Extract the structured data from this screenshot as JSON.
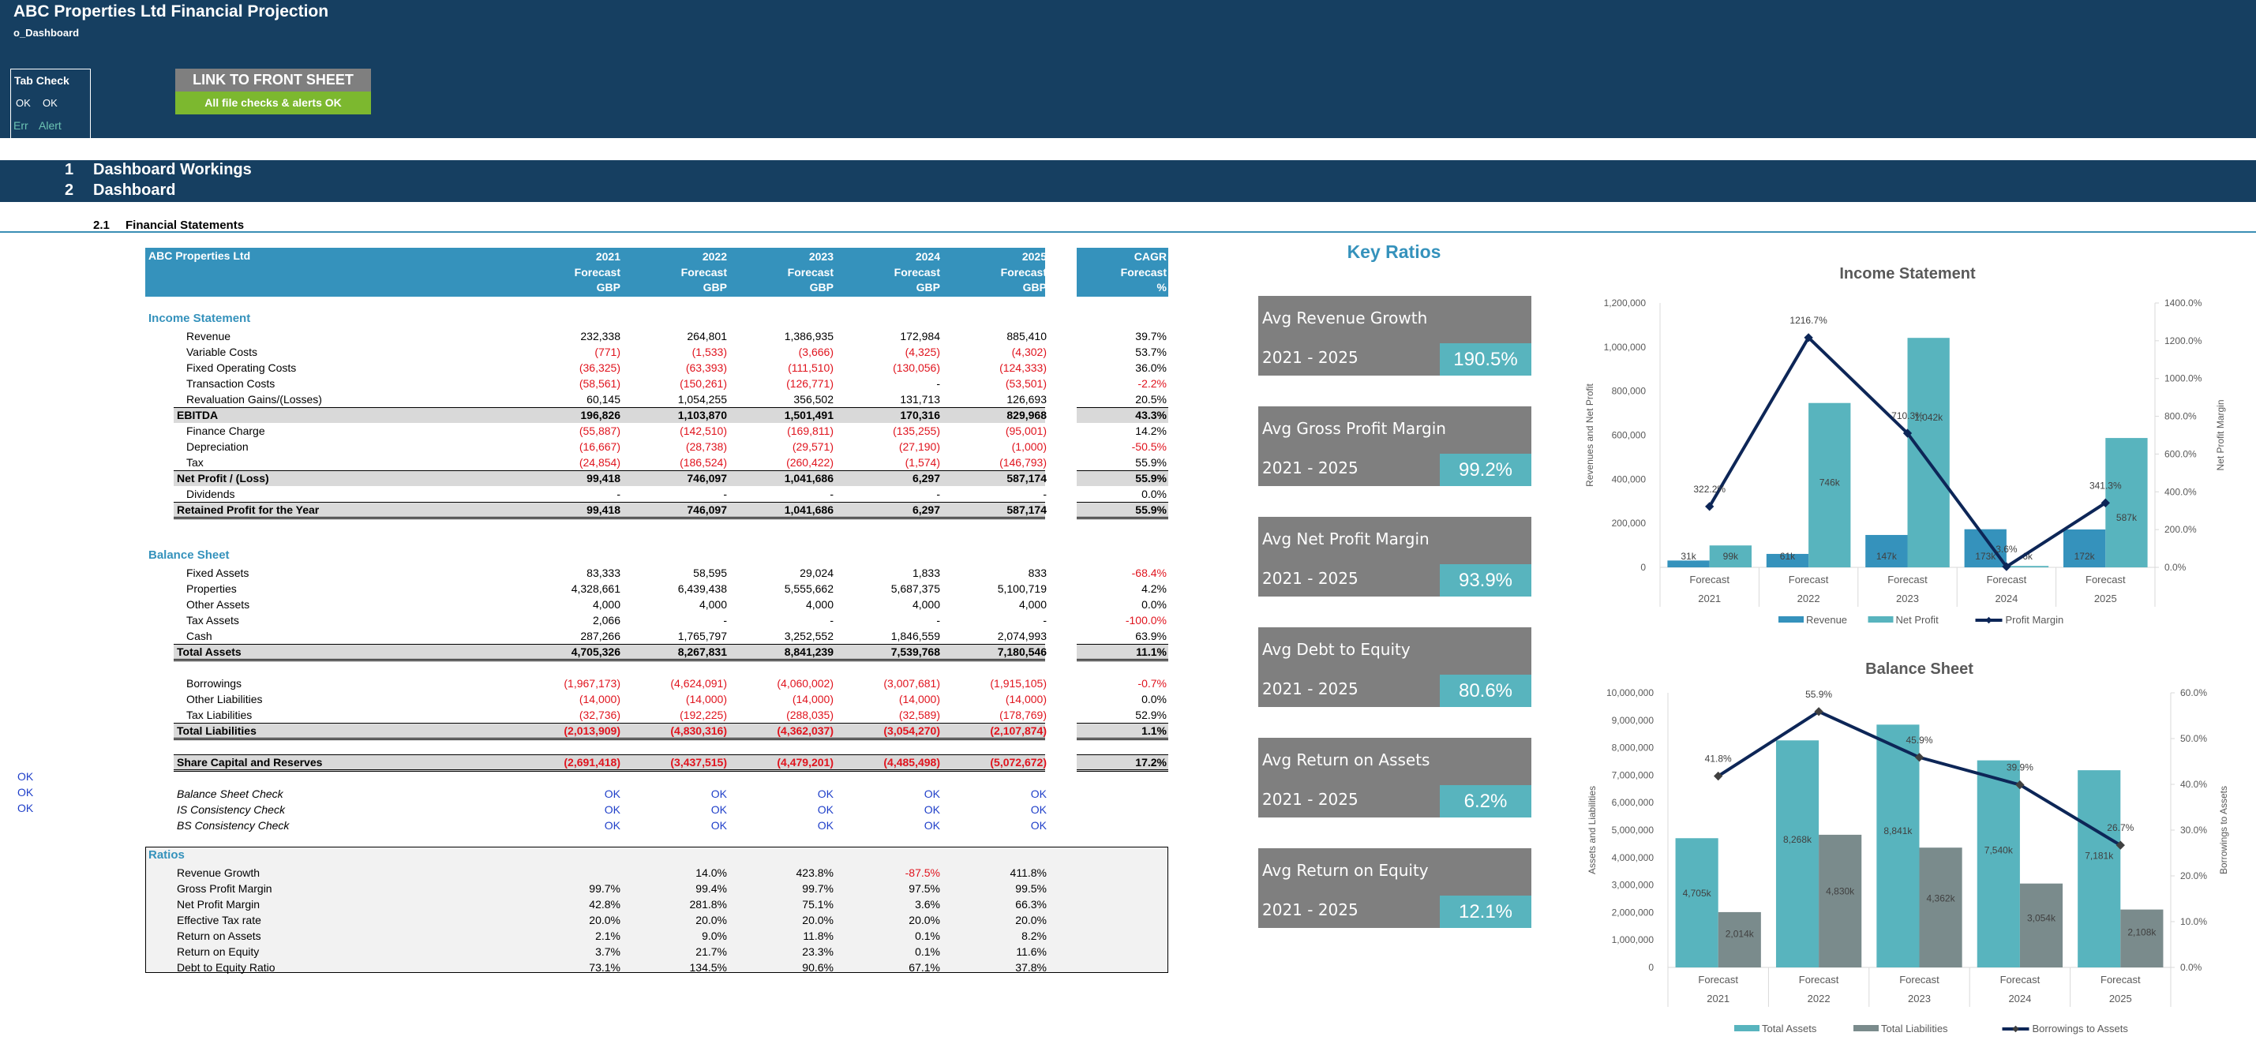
{
  "header": {
    "title": "ABC Properties Ltd Financial Projection",
    "sheet": "o_Dashboard",
    "tab_check": {
      "title": "Tab Check",
      "ok1": "OK",
      "ok2": "OK",
      "err": "Err",
      "alert": "Alert"
    },
    "link_button": "LINK TO FRONT SHEET",
    "checks_status": "All file checks & alerts OK"
  },
  "sections": [
    {
      "num": "1",
      "label": "Dashboard Workings"
    },
    {
      "num": "2",
      "label": "Dashboard"
    }
  ],
  "subsection": {
    "num": "2.1",
    "label": "Financial Statements"
  },
  "table": {
    "company": "ABC Properties Ltd",
    "columns": [
      {
        "year": "2021",
        "type": "Forecast",
        "unit": "GBP"
      },
      {
        "year": "2022",
        "type": "Forecast",
        "unit": "GBP"
      },
      {
        "year": "2023",
        "type": "Forecast",
        "unit": "GBP"
      },
      {
        "year": "2024",
        "type": "Forecast",
        "unit": "GBP"
      },
      {
        "year": "2025",
        "type": "Forecast",
        "unit": "GBP"
      }
    ],
    "cagr": {
      "label": "CAGR",
      "type": "Forecast",
      "unit": "%"
    },
    "income_statement": {
      "title": "Income Statement",
      "rows": [
        {
          "label": "Revenue",
          "kind": "item",
          "values": [
            "232,338",
            "264,801",
            "1,386,935",
            "172,984",
            "885,410"
          ],
          "cagr": "39.7%"
        },
        {
          "label": "Variable Costs",
          "kind": "item",
          "values": [
            "(771)",
            "(1,533)",
            "(3,666)",
            "(4,325)",
            "(4,302)"
          ],
          "cagr": "53.7%"
        },
        {
          "label": "Fixed Operating Costs",
          "kind": "item",
          "values": [
            "(36,325)",
            "(63,393)",
            "(111,510)",
            "(130,056)",
            "(124,333)"
          ],
          "cagr": "36.0%"
        },
        {
          "label": "Transaction Costs",
          "kind": "item",
          "values": [
            "(58,561)",
            "(150,261)",
            "(126,771)",
            "-",
            "(53,501)"
          ],
          "cagr": "-2.2%"
        },
        {
          "label": "Revaluation Gains/(Losses)",
          "kind": "item",
          "values": [
            "60,145",
            "1,054,255",
            "356,502",
            "131,713",
            "126,693"
          ],
          "cagr": "20.5%"
        },
        {
          "label": "EBITDA",
          "kind": "total",
          "values": [
            "196,826",
            "1,103,870",
            "1,501,491",
            "170,316",
            "829,968"
          ],
          "cagr": "43.3%"
        },
        {
          "label": "Finance Charge",
          "kind": "item",
          "values": [
            "(55,887)",
            "(142,510)",
            "(169,811)",
            "(135,255)",
            "(95,001)"
          ],
          "cagr": "14.2%"
        },
        {
          "label": "Depreciation",
          "kind": "item",
          "values": [
            "(16,667)",
            "(28,738)",
            "(29,571)",
            "(27,190)",
            "(1,000)"
          ],
          "cagr": "-50.5%"
        },
        {
          "label": "Tax",
          "kind": "item",
          "values": [
            "(24,854)",
            "(186,524)",
            "(260,422)",
            "(1,574)",
            "(146,793)"
          ],
          "cagr": "55.9%"
        },
        {
          "label": "Net Profit / (Loss)",
          "kind": "total",
          "values": [
            "99,418",
            "746,097",
            "1,041,686",
            "6,297",
            "587,174"
          ],
          "cagr": "55.9%"
        },
        {
          "label": "Dividends",
          "kind": "item",
          "values": [
            "-",
            "-",
            "-",
            "-",
            "-"
          ],
          "cagr": "0.0%"
        },
        {
          "label": "Retained Profit for the Year",
          "kind": "total-dbl",
          "values": [
            "99,418",
            "746,097",
            "1,041,686",
            "6,297",
            "587,174"
          ],
          "cagr": "55.9%"
        }
      ]
    },
    "balance_sheet": {
      "title": "Balance Sheet",
      "rows": [
        {
          "label": "Fixed Assets",
          "kind": "item",
          "values": [
            "83,333",
            "58,595",
            "29,024",
            "1,833",
            "833"
          ],
          "cagr": "-68.4%"
        },
        {
          "label": "Properties",
          "kind": "item",
          "values": [
            "4,328,661",
            "6,439,438",
            "5,555,662",
            "5,687,375",
            "5,100,719"
          ],
          "cagr": "4.2%"
        },
        {
          "label": "Other Assets",
          "kind": "item",
          "values": [
            "4,000",
            "4,000",
            "4,000",
            "4,000",
            "4,000"
          ],
          "cagr": "0.0%"
        },
        {
          "label": "Tax Assets",
          "kind": "item",
          "values": [
            "2,066",
            "-",
            "-",
            "-",
            "-"
          ],
          "cagr": "-100.0%"
        },
        {
          "label": "Cash",
          "kind": "item",
          "values": [
            "287,266",
            "1,765,797",
            "3,252,552",
            "1,846,559",
            "2,074,993"
          ],
          "cagr": "63.9%"
        },
        {
          "label": "Total Assets",
          "kind": "total-dbl",
          "values": [
            "4,705,326",
            "8,267,831",
            "8,841,239",
            "7,539,768",
            "7,180,546"
          ],
          "cagr": "11.1%"
        },
        {
          "label": "",
          "kind": "blank"
        },
        {
          "label": "Borrowings",
          "kind": "item",
          "values": [
            "(1,967,173)",
            "(4,624,091)",
            "(4,060,002)",
            "(3,007,681)",
            "(1,915,105)"
          ],
          "cagr": "-0.7%"
        },
        {
          "label": "Other Liabilities",
          "kind": "item",
          "values": [
            "(14,000)",
            "(14,000)",
            "(14,000)",
            "(14,000)",
            "(14,000)"
          ],
          "cagr": "0.0%"
        },
        {
          "label": "Tax Liabilities",
          "kind": "item",
          "values": [
            "(32,736)",
            "(192,225)",
            "(288,035)",
            "(32,589)",
            "(178,769)"
          ],
          "cagr": "52.9%"
        },
        {
          "label": "Total Liabilities",
          "kind": "total-dbl",
          "values": [
            "(2,013,909)",
            "(4,830,316)",
            "(4,362,037)",
            "(3,054,270)",
            "(2,107,874)"
          ],
          "cagr": "1.1%"
        },
        {
          "label": "",
          "kind": "blank"
        },
        {
          "label": "Share Capital and Reserves",
          "kind": "total-dbl",
          "values": [
            "(2,691,418)",
            "(3,437,515)",
            "(4,479,201)",
            "(4,485,498)",
            "(5,072,672)"
          ],
          "cagr": "17.2%"
        }
      ]
    },
    "checks": {
      "left_flags": [
        "OK",
        "OK",
        "OK"
      ],
      "rows": [
        {
          "label": "Balance Sheet Check",
          "values": [
            "OK",
            "OK",
            "OK",
            "OK",
            "OK"
          ]
        },
        {
          "label": "IS Consistency Check",
          "values": [
            "OK",
            "OK",
            "OK",
            "OK",
            "OK"
          ]
        },
        {
          "label": "BS Consistency Check",
          "values": [
            "OK",
            "OK",
            "OK",
            "OK",
            "OK"
          ]
        }
      ]
    },
    "ratios": {
      "title": "Ratios",
      "rows": [
        {
          "label": "Revenue Growth",
          "values": [
            "",
            "14.0%",
            "423.8%",
            "-87.5%",
            "411.8%"
          ]
        },
        {
          "label": "Gross Profit Margin",
          "values": [
            "99.7%",
            "99.4%",
            "99.7%",
            "97.5%",
            "99.5%"
          ]
        },
        {
          "label": "Net Profit Margin",
          "values": [
            "42.8%",
            "281.8%",
            "75.1%",
            "3.6%",
            "66.3%"
          ]
        },
        {
          "label": "Effective Tax rate",
          "values": [
            "20.0%",
            "20.0%",
            "20.0%",
            "20.0%",
            "20.0%"
          ]
        },
        {
          "label": "Return on Assets",
          "values": [
            "2.1%",
            "9.0%",
            "11.8%",
            "0.1%",
            "8.2%"
          ]
        },
        {
          "label": "Return on Equity",
          "values": [
            "3.7%",
            "21.7%",
            "23.3%",
            "0.1%",
            "11.6%"
          ]
        },
        {
          "label": "Debt to Equity Ratio",
          "values": [
            "73.1%",
            "134.5%",
            "90.6%",
            "67.1%",
            "37.8%"
          ]
        }
      ]
    }
  },
  "key_ratios": {
    "title": "Key Ratios",
    "cards": [
      {
        "name": "Avg Revenue Growth",
        "period": "2021 - 2025",
        "value": "190.5%"
      },
      {
        "name": "Avg Gross Profit Margin",
        "period": "2021 - 2025",
        "value": "99.2%"
      },
      {
        "name": "Avg Net Profit Margin",
        "period": "2021 - 2025",
        "value": "93.9%"
      },
      {
        "name": "Avg Debt to Equity",
        "period": "2021 - 2025",
        "value": "80.6%"
      },
      {
        "name": "Avg Return on Assets",
        "period": "2021 - 2025",
        "value": "6.2%"
      },
      {
        "name": "Avg Return on Equity",
        "period": "2021 - 2025",
        "value": "12.1%"
      }
    ]
  },
  "colors": {
    "navy": "#163f61",
    "table_header": "#3592bc",
    "teal": "#58b4be",
    "revenue_bar": "#3592bc",
    "liabilities_bar": "#7a8b8c",
    "line": "#0d2657",
    "card_gray": "#7f7f7f",
    "ok_green": "#7cb82f",
    "negative": "#e0141e"
  },
  "chart_data": [
    {
      "type": "bar",
      "title": "Income Statement",
      "categories": [
        "Forecast|2021",
        "Forecast|2022",
        "Forecast|2023",
        "Forecast|2024",
        "Forecast|2025"
      ],
      "series": [
        {
          "name": "Revenue",
          "axis": "left",
          "values": [
            31000,
            61000,
            147000,
            173000,
            172000
          ],
          "labels": [
            "31k",
            "61k",
            "147k",
            "173k",
            "172k"
          ]
        },
        {
          "name": "Net Profit",
          "axis": "left",
          "values": [
            99418,
            746097,
            1041686,
            6297,
            587174
          ],
          "labels": [
            "99k",
            "746k",
            "1,042k",
            "6k",
            "587k"
          ]
        },
        {
          "name": "Profit Margin",
          "axis": "right",
          "kind": "line",
          "values": [
            322.2,
            1216.7,
            710.3,
            3.6,
            341.3
          ],
          "labels": [
            "322.2%",
            "1216.7%",
            "710.3%",
            "3.6%",
            "341.3%"
          ]
        }
      ],
      "ylabel": "Revenues and Net Profit",
      "y2label": "Net Profit Margin",
      "ylim": [
        0,
        1200000
      ],
      "yticks": [
        "0",
        "200,000",
        "400,000",
        "600,000",
        "800,000",
        "1,000,000",
        "1,200,000"
      ],
      "y2lim": [
        0,
        1400
      ],
      "y2ticks": [
        "0.0%",
        "200.0%",
        "400.0%",
        "600.0%",
        "800.0%",
        "1000.0%",
        "1200.0%",
        "1400.0%"
      ],
      "legend": "bottom"
    },
    {
      "type": "bar",
      "title": "Balance Sheet",
      "categories": [
        "Forecast|2021",
        "Forecast|2022",
        "Forecast|2023",
        "Forecast|2024",
        "Forecast|2025"
      ],
      "series": [
        {
          "name": "Total Assets",
          "axis": "left",
          "values": [
            4705326,
            8267831,
            8841239,
            7539768,
            7180546
          ],
          "labels": [
            "4,705k",
            "8,268k",
            "8,841k",
            "7,540k",
            "7,181k"
          ]
        },
        {
          "name": "Total Liabilities",
          "axis": "left",
          "values": [
            2013909,
            4830316,
            4362037,
            3054270,
            2107874
          ],
          "labels": [
            "2,014k",
            "4,830k",
            "4,362k",
            "3,054k",
            "2,108k"
          ]
        },
        {
          "name": "Borrowings to Assets",
          "axis": "right",
          "kind": "line",
          "values": [
            41.8,
            55.9,
            45.9,
            39.9,
            26.7
          ],
          "labels": [
            "41.8%",
            "55.9%",
            "45.9%",
            "39.9%",
            "26.7%"
          ]
        }
      ],
      "ylabel": "Assets and Liabilities",
      "y2label": "Borrowings to Assets",
      "ylim": [
        0,
        10000000
      ],
      "yticks": [
        "0",
        "1,000,000",
        "2,000,000",
        "3,000,000",
        "4,000,000",
        "5,000,000",
        "6,000,000",
        "7,000,000",
        "8,000,000",
        "9,000,000",
        "10,000,000"
      ],
      "y2lim": [
        0,
        60
      ],
      "y2ticks": [
        "0.0%",
        "10.0%",
        "20.0%",
        "30.0%",
        "40.0%",
        "50.0%",
        "60.0%"
      ],
      "legend": "bottom"
    }
  ]
}
